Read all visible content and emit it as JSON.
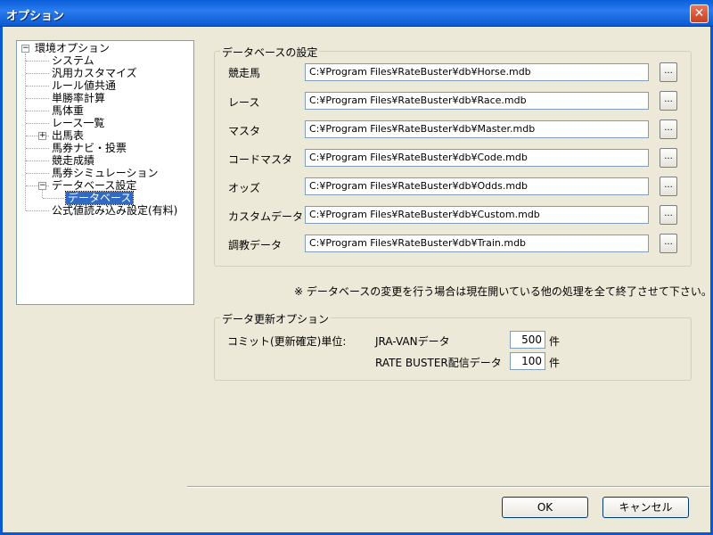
{
  "window": {
    "title": "オプション",
    "close_glyph": "✕"
  },
  "tree": {
    "root": {
      "label": "環境オプション",
      "toggle": "−"
    },
    "items": [
      {
        "label": "システム"
      },
      {
        "label": "汎用カスタマイズ"
      },
      {
        "label": "ルール値共通"
      },
      {
        "label": "単勝率計算"
      },
      {
        "label": "馬体重"
      },
      {
        "label": "レース一覧"
      },
      {
        "label": "出馬表",
        "toggle": "+"
      },
      {
        "label": "馬券ナビ・投票"
      },
      {
        "label": "競走成績"
      },
      {
        "label": "馬券シミュレーション"
      },
      {
        "label": "データベース設定",
        "toggle": "−"
      },
      {
        "label": "データベース",
        "selected": true
      },
      {
        "label": "公式値読み込み設定(有料)"
      }
    ]
  },
  "db_group": {
    "title": "データベースの設定",
    "rows": [
      {
        "label": "競走馬",
        "path": "C:¥Program Files¥RateBuster¥db¥Horse.mdb",
        "button": "..."
      },
      {
        "label": "レース",
        "path": "C:¥Program Files¥RateBuster¥db¥Race.mdb",
        "button": "..."
      },
      {
        "label": "マスタ",
        "path": "C:¥Program Files¥RateBuster¥db¥Master.mdb",
        "button": "..."
      },
      {
        "label": "コードマスタ",
        "path": "C:¥Program Files¥RateBuster¥db¥Code.mdb",
        "button": "..."
      },
      {
        "label": "オッズ",
        "path": "C:¥Program Files¥RateBuster¥db¥Odds.mdb",
        "button": "..."
      },
      {
        "label": "カスタムデータ",
        "path": "C:¥Program Files¥RateBuster¥db¥Custom.mdb",
        "button": "..."
      },
      {
        "label": "調教データ",
        "path": "C:¥Program Files¥RateBuster¥db¥Train.mdb",
        "button": "..."
      }
    ]
  },
  "note": "※ データベースの変更を行う場合は現在開いている他の処理を全て終了させて下さい。",
  "update_group": {
    "title": "データ更新オプション",
    "commit_label": "コミット(更新確定)単位:",
    "jra_label": "JRA-VANデータ",
    "jra_value": "500",
    "rb_label": "RATE BUSTER配信データ",
    "rb_value": "100",
    "unit": "件"
  },
  "buttons": {
    "ok": "OK",
    "cancel": "キャンセル"
  }
}
